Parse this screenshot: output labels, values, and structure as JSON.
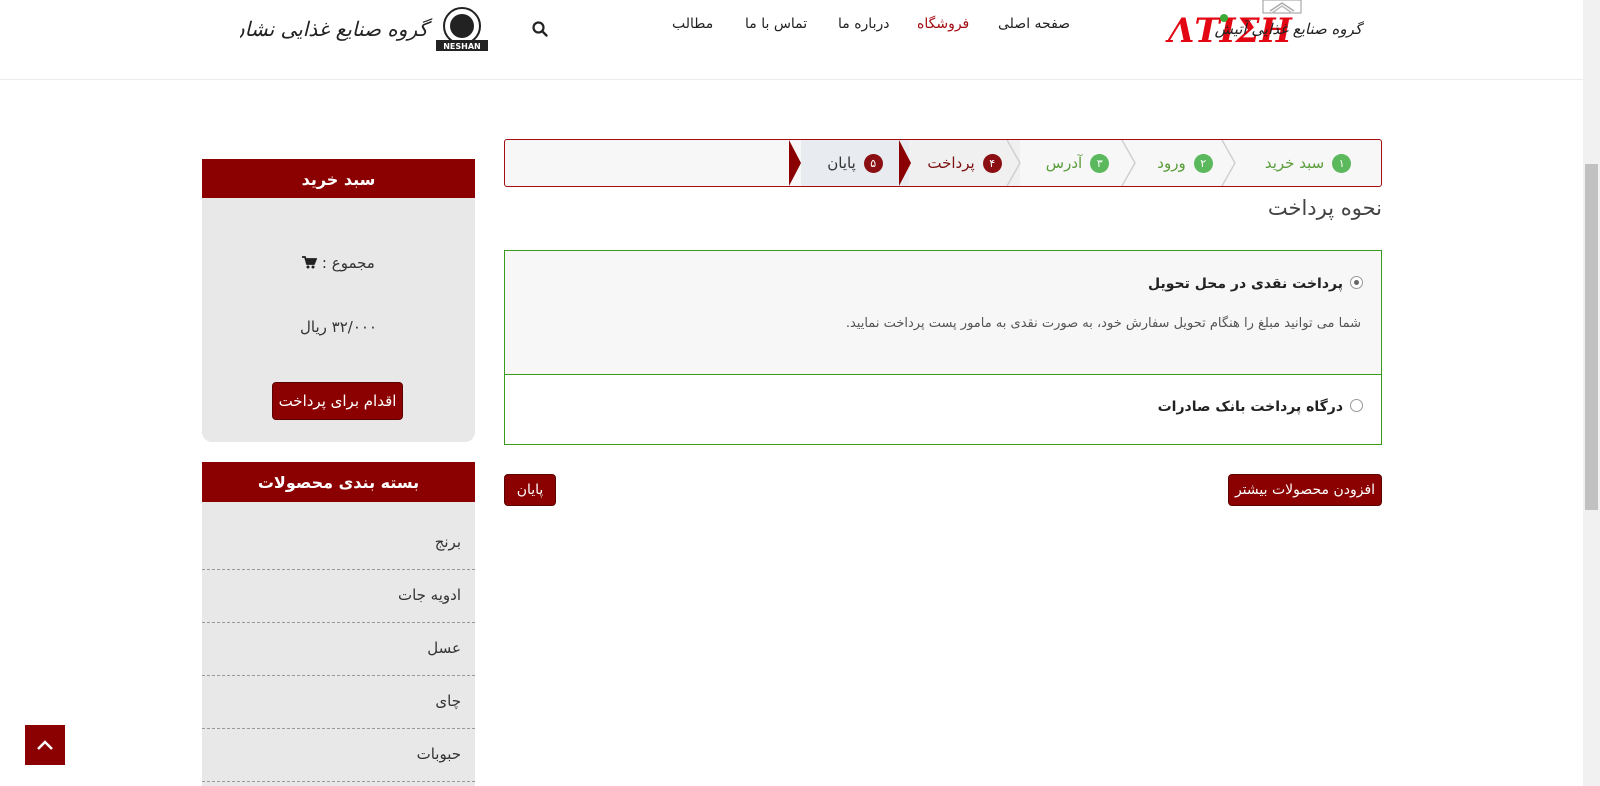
{
  "header": {
    "logo_right_text": "گروه صنایع غذایی آتیش",
    "logo_left_text": "گروه صنایع غذایی نشان",
    "logo_left_badge": "NESHAN",
    "nav": {
      "home": "صفحه اصلی",
      "shop": "فروشگاه",
      "about": "درباره ما",
      "contact": "تماس با ما",
      "articles": "مطالب"
    }
  },
  "steps": {
    "s1": {
      "num": "۱",
      "label": "سبد خرید"
    },
    "s2": {
      "num": "۲",
      "label": "ورود"
    },
    "s3": {
      "num": "۳",
      "label": "آدرس"
    },
    "s4": {
      "num": "۴",
      "label": "پرداخت"
    },
    "s5": {
      "num": "۵",
      "label": "پایان"
    }
  },
  "payment": {
    "title": "نحوه پرداخت",
    "option1_label": "پرداخت نقدی در محل تحویل",
    "option1_desc": "شما می توانید مبلغ را هنگام تحویل سفارش خود، به صورت نقدی به مامور پست پرداخت نمایید.",
    "option2_label": "درگاه پرداخت بانک صادرات",
    "finish_button": "پایان",
    "add_more_button": "افزودن محصولات بیشتر"
  },
  "cart": {
    "title": "سبد خرید",
    "total_label": "مجموع :",
    "amount": "۳۲/۰۰۰ ریال",
    "checkout_button": "اقدام برای پرداخت"
  },
  "categories": {
    "title": "بسته بندی محصولات",
    "items": [
      "برنج",
      "ادویه جات",
      "عسل",
      "چای",
      "حبوبات"
    ]
  },
  "colors": {
    "brand": "#8b0000",
    "success": "#5cb85c",
    "border_green": "#3a9a1a"
  }
}
